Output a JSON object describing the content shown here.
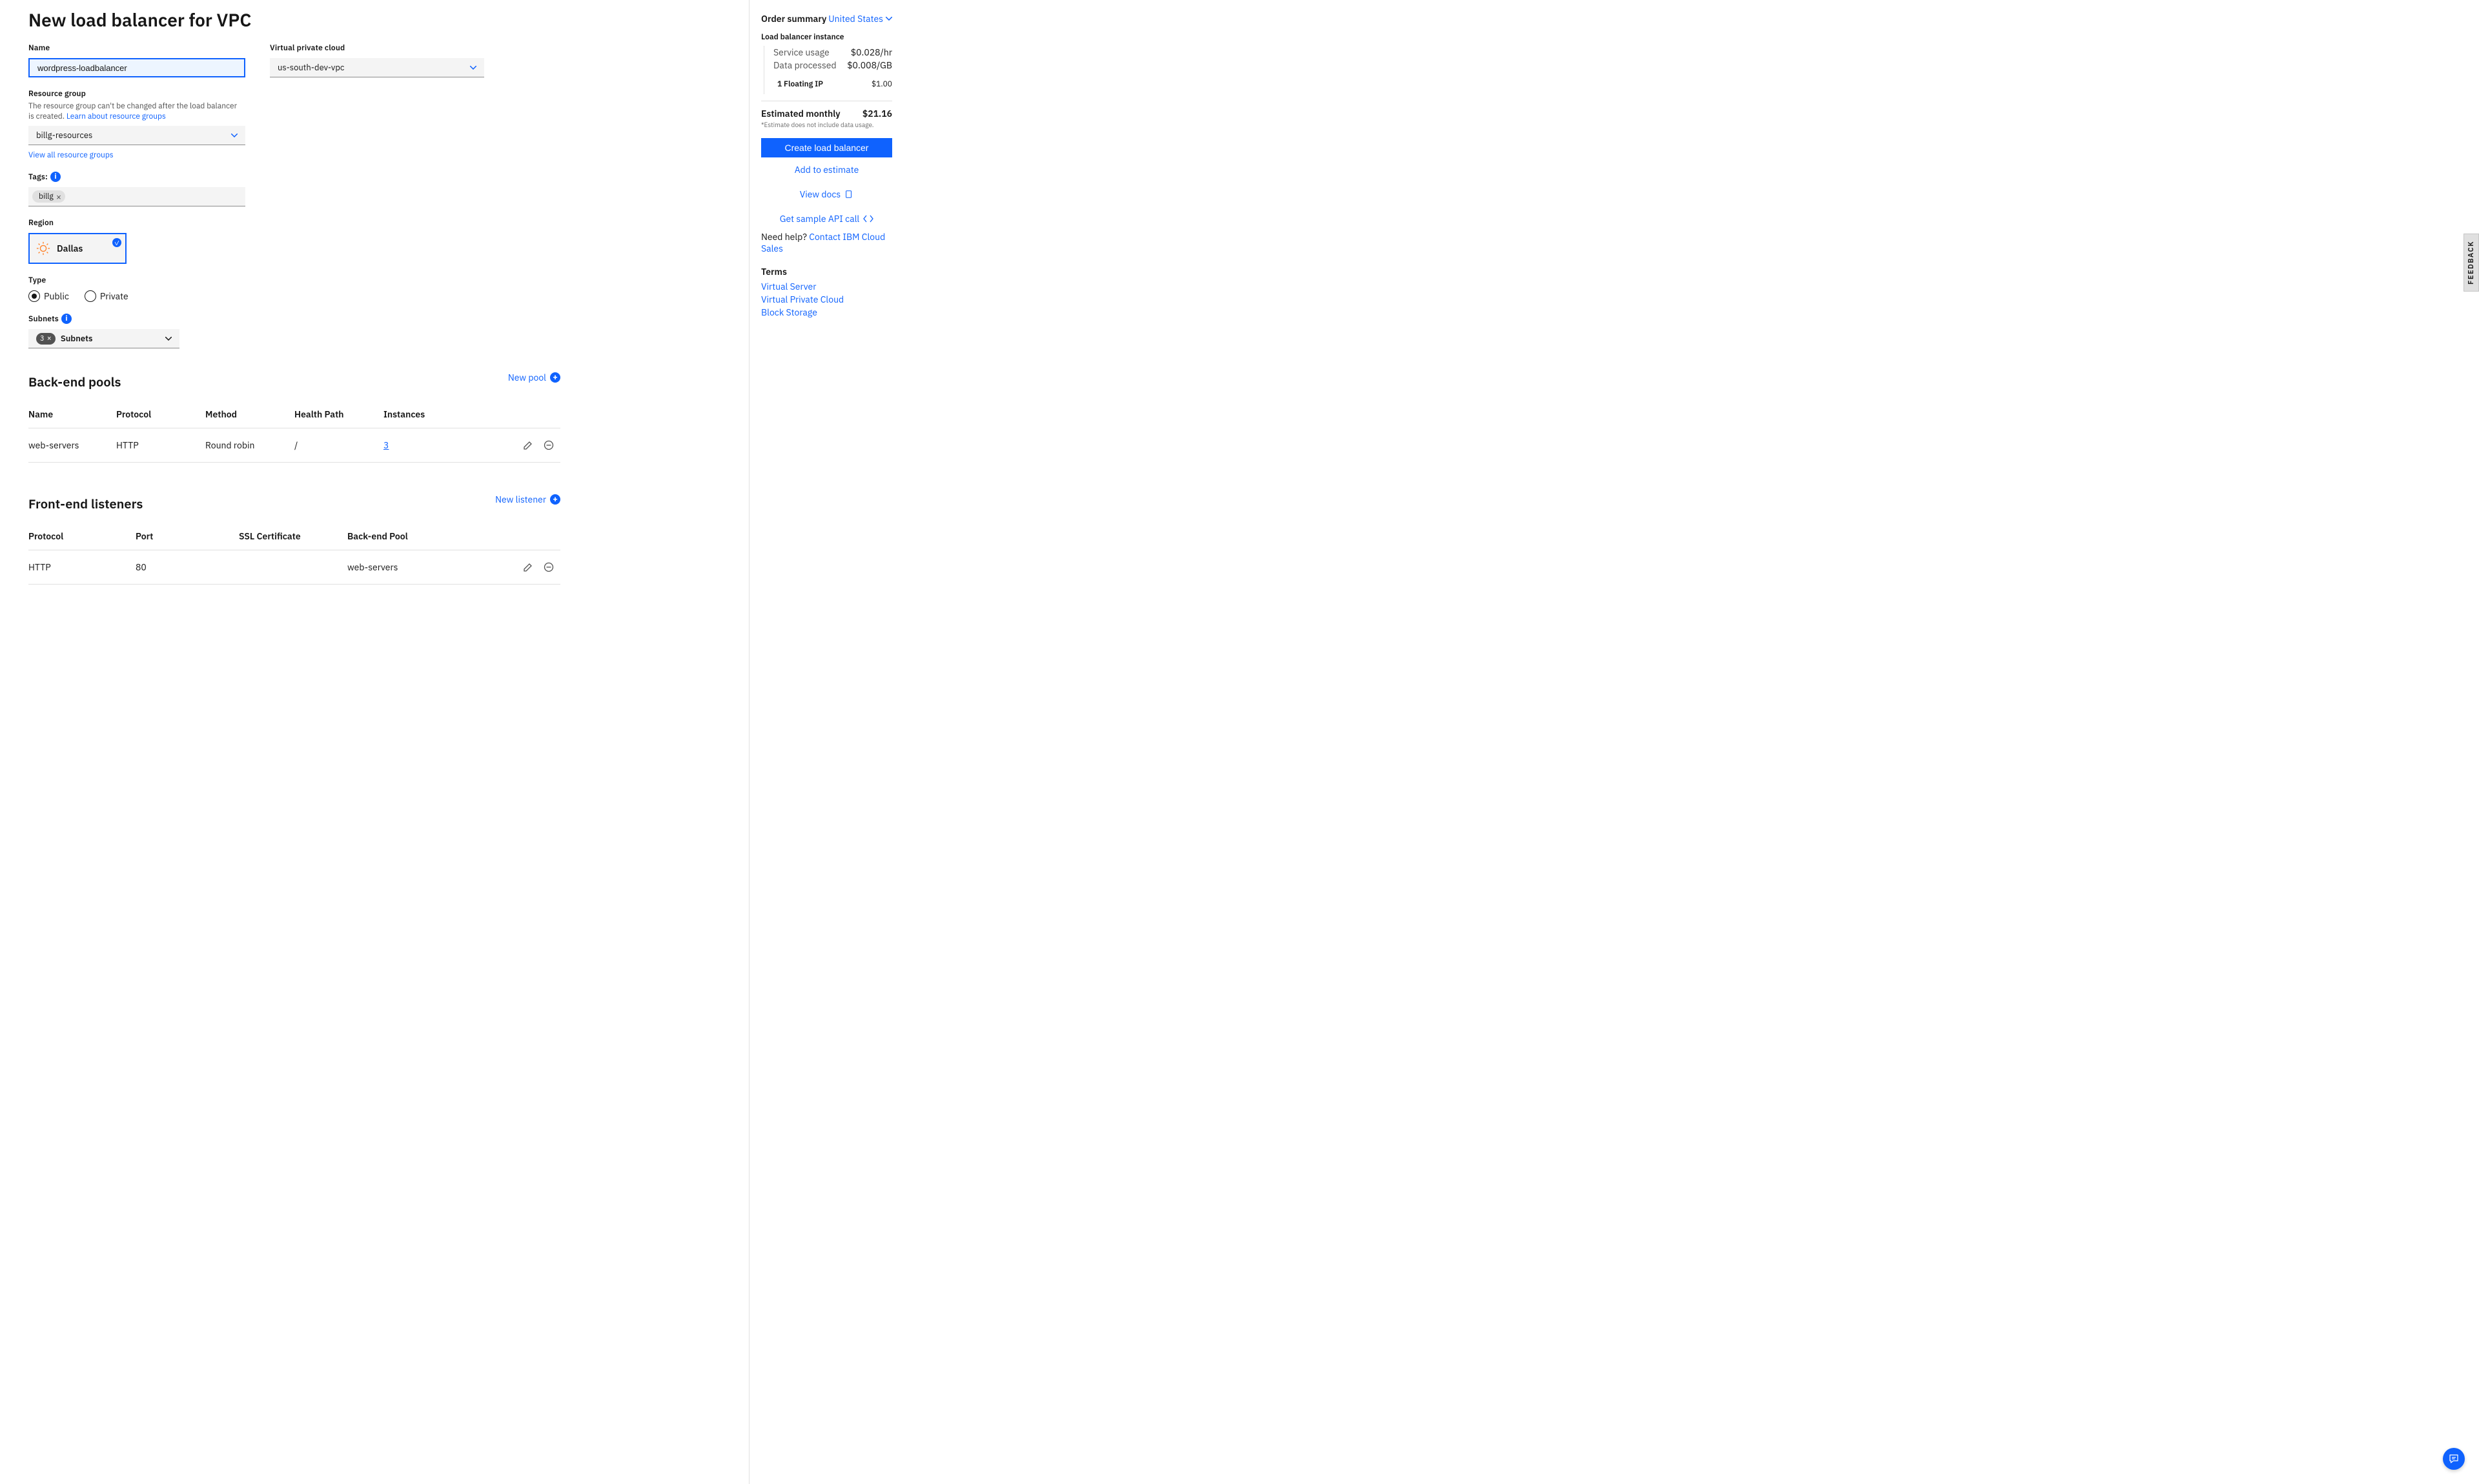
{
  "page": {
    "title": "New load balancer for VPC"
  },
  "fields": {
    "name": {
      "label": "Name",
      "value": "wordpress-loadbalancer"
    },
    "vpc": {
      "label": "Virtual private cloud",
      "value": "us-south-dev-vpc"
    },
    "rg": {
      "label": "Resource group",
      "help_pre": "The resource group can't be changed after the load balancer is created. ",
      "help_link": "Learn about resource groups",
      "value": "billg-resources",
      "view_all": "View all resource groups"
    },
    "tags": {
      "label": "Tags:",
      "chip": "billg"
    },
    "region": {
      "label": "Region",
      "value": "Dallas"
    },
    "type": {
      "label": "Type",
      "public": "Public",
      "private": "Private"
    },
    "subnets": {
      "label": "Subnets",
      "count": "3",
      "text": "Subnets"
    }
  },
  "backend": {
    "title": "Back-end pools",
    "new": "New pool",
    "cols": {
      "name": "Name",
      "protocol": "Protocol",
      "method": "Method",
      "health": "Health Path",
      "instances": "Instances"
    },
    "row": {
      "name": "web-servers",
      "protocol": "HTTP",
      "method": "Round robin",
      "health": "/",
      "instances": "3"
    }
  },
  "frontend": {
    "title": "Front-end listeners",
    "new": "New listener",
    "cols": {
      "protocol": "Protocol",
      "port": "Port",
      "ssl": "SSL Certificate",
      "pool": "Back-end Pool"
    },
    "row": {
      "protocol": "HTTP",
      "port": "80",
      "ssl": "",
      "pool": "web-servers"
    }
  },
  "summary": {
    "title": "Order summary",
    "region": "United States",
    "instance_h": "Load balancer instance",
    "usage_l": "Service usage",
    "usage_v": "$0.028/hr",
    "data_l": "Data processed",
    "data_v": "$0.008/GB",
    "fip_l": "1 Floating IP",
    "fip_v": "$1.00",
    "est_l": "Estimated monthly",
    "est_v": "$21.16",
    "note": "*Estimate does not include data usage.",
    "create_btn": "Create load balancer",
    "add_estimate": "Add to estimate",
    "view_docs": "View docs",
    "sample_api": "Get sample API call",
    "help_q": "Need help? ",
    "help_link": "Contact IBM Cloud Sales",
    "terms_h": "Terms",
    "terms": [
      "Virtual Server",
      "Virtual Private Cloud",
      "Block Storage"
    ]
  },
  "misc": {
    "feedback": "FEEDBACK"
  }
}
